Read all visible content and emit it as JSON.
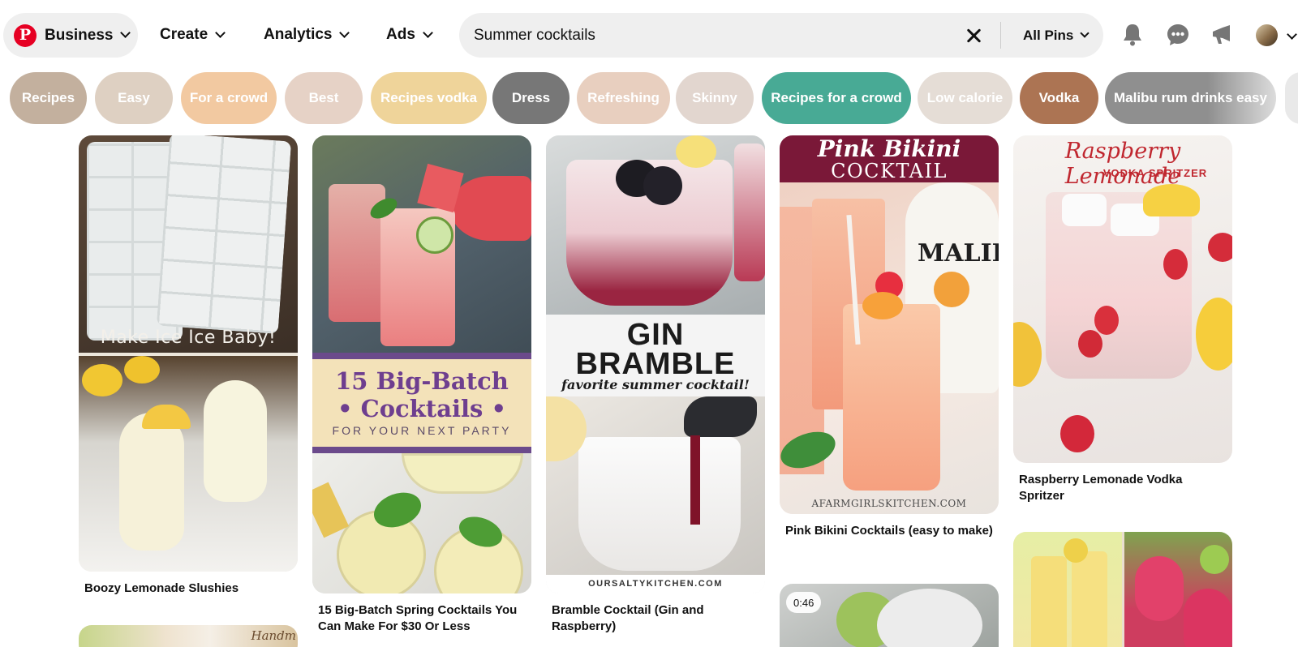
{
  "header": {
    "business_label": "Business",
    "logo_letter": "P",
    "nav": {
      "create": "Create",
      "analytics": "Analytics",
      "ads": "Ads"
    },
    "search": {
      "value": "Summer cocktails",
      "scope": "All Pins"
    }
  },
  "chips": [
    {
      "label": "Recipes",
      "color": "#c3b09e"
    },
    {
      "label": "Easy",
      "color": "#ded0c2"
    },
    {
      "label": "For a crowd",
      "color": "#f2c9a1"
    },
    {
      "label": "Best",
      "color": "#e6d2c6"
    },
    {
      "label": "Recipes vodka",
      "color": "#efd49a"
    },
    {
      "label": "Dress",
      "color": "#777777"
    },
    {
      "label": "Refreshing",
      "color": "#e8cfbf"
    },
    {
      "label": "Skinny",
      "color": "#e2d6cf"
    },
    {
      "label": "Recipes for a crowd",
      "color": "#48aa95"
    },
    {
      "label": "Low calorie",
      "color": "#e5ddd6"
    },
    {
      "label": "Vodka",
      "color": "#ac7453"
    },
    {
      "label": "Malibu rum drinks easy",
      "color": "#8f8f8f"
    }
  ],
  "pins": {
    "boozy": {
      "title": "Boozy Lemonade Slushies",
      "overlay": "Make Ice Ice Baby!"
    },
    "bigbatch": {
      "title": "15 Big-Batch Spring Cocktails You Can Make For $30 Or Less",
      "overlay_line1": "15 Big-Batch",
      "overlay_line2": "• Cocktails •",
      "overlay_line3": "FOR YOUR NEXT PARTY"
    },
    "bramble": {
      "title": "Bramble Cocktail (Gin and Raspberry)",
      "overlay_line1": "GIN",
      "overlay_line2": "BRAMBLE",
      "overlay_line3": "favorite summer cocktail!",
      "footer": "OURSALTYKITCHEN.COM"
    },
    "pinkbikini": {
      "title": "Pink Bikini Cocktails (easy to make)",
      "overlay_line1": "Pink Bikini",
      "overlay_line2": "COCKTAIL",
      "bottle_text": "MALIBU",
      "footer": "AFARMGIRLSKITCHEN.COM"
    },
    "raspberry": {
      "title": "Raspberry Lemonade Vodka Spritzer",
      "overlay_line1": "Raspberry Lemonade",
      "overlay_line2": "VODKA SPRITZER"
    },
    "video": {
      "duration": "0:46"
    },
    "handmade": {
      "label": "Handm"
    }
  },
  "colors": {
    "brand": "#e60023",
    "bg": "#ffffff",
    "pill": "#efefef"
  },
  "icons": [
    "pinterest-logo-icon",
    "chevron-down-icon",
    "close-icon",
    "bell-icon",
    "chat-bubble-icon",
    "megaphone-icon",
    "avatar"
  ]
}
